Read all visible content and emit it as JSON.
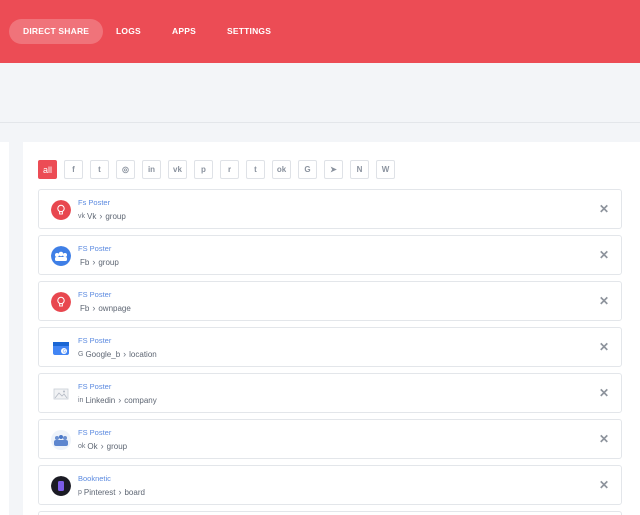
{
  "nav": {
    "items": [
      {
        "label": "DIRECT SHARE",
        "active": true
      },
      {
        "label": "LOGS",
        "active": false
      },
      {
        "label": "APPS",
        "active": false
      },
      {
        "label": "SETTINGS",
        "active": false
      }
    ]
  },
  "colors": {
    "accent": "#ec4c55",
    "link": "#5b8ae0",
    "text_muted": "#5e6673"
  },
  "filters": [
    {
      "label": "all",
      "icon": "all",
      "active": true
    },
    {
      "icon": "facebook-icon",
      "glyph": "f"
    },
    {
      "icon": "twitter-icon",
      "glyph": "t"
    },
    {
      "icon": "instagram-icon",
      "glyph": "◎"
    },
    {
      "icon": "linkedin-icon",
      "glyph": "in"
    },
    {
      "icon": "vk-icon",
      "glyph": "vk"
    },
    {
      "icon": "pinterest-icon",
      "glyph": "p"
    },
    {
      "icon": "reddit-icon",
      "glyph": "r"
    },
    {
      "icon": "tumblr-icon",
      "glyph": "t"
    },
    {
      "icon": "odnoklassniki-icon",
      "glyph": "ok"
    },
    {
      "icon": "google-icon",
      "glyph": "G"
    },
    {
      "icon": "telegram-icon",
      "glyph": "➤"
    },
    {
      "icon": "medium-icon",
      "glyph": "N"
    },
    {
      "icon": "wordpress-icon",
      "glyph": "W"
    }
  ],
  "accounts": [
    {
      "name": "Fs Poster",
      "network": "Vk",
      "type": "group",
      "network_icon": "vk-icon",
      "network_glyph": "vk",
      "avatar": "fs-poster-red"
    },
    {
      "name": "FS Poster",
      "network": "Fb",
      "type": "group",
      "network_icon": "facebook-icon",
      "network_glyph": "",
      "avatar": "group-blue"
    },
    {
      "name": "FS Poster",
      "network": "Fb",
      "type": "ownpage",
      "network_icon": "facebook-icon",
      "network_glyph": "",
      "avatar": "fs-poster-red"
    },
    {
      "name": "FS Poster",
      "network": "Google_b",
      "type": "location",
      "network_icon": "google-icon",
      "network_glyph": "G",
      "avatar": "google-business"
    },
    {
      "name": "FS Poster",
      "network": "Linkedin",
      "type": "company",
      "network_icon": "linkedin-icon",
      "network_glyph": "in",
      "avatar": "image-placeholder"
    },
    {
      "name": "FS Poster",
      "network": "Ok",
      "type": "group",
      "network_icon": "odnoklassniki-icon",
      "network_glyph": "ok",
      "avatar": "team-photo"
    },
    {
      "name": "Booknetic",
      "network": "Pinterest",
      "type": "board",
      "network_icon": "pinterest-icon",
      "network_glyph": "p",
      "avatar": "booknetic-dark"
    }
  ]
}
